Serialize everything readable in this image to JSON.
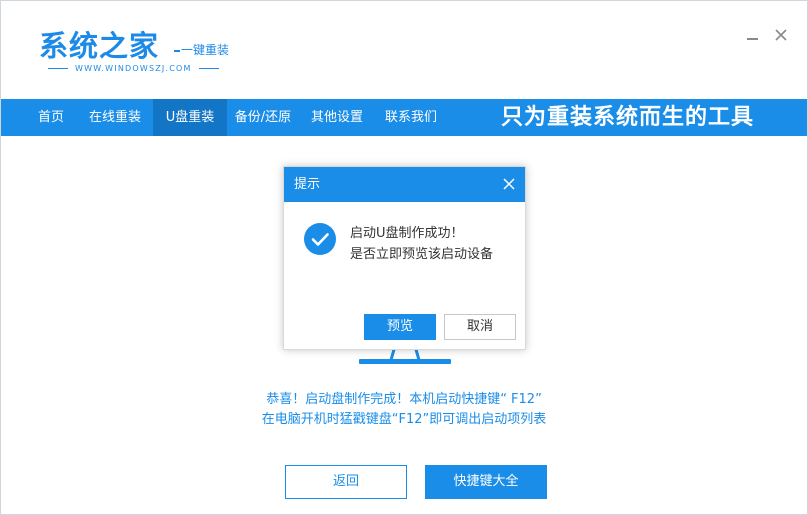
{
  "header": {
    "logo_title": "系统之家",
    "logo_subtitle": "一键重装",
    "logo_url": "WWW.WINDOWSZJ.COM"
  },
  "window_controls": {
    "minimize_icon": "minimize-icon",
    "close_icon": "close-icon"
  },
  "nav": {
    "items": [
      {
        "label": "首页",
        "active": false
      },
      {
        "label": "在线重装",
        "active": false
      },
      {
        "label": "U盘重装",
        "active": true
      },
      {
        "label": "备份/还原",
        "active": false
      },
      {
        "label": "其他设置",
        "active": false
      },
      {
        "label": "联系我们",
        "active": false
      }
    ],
    "slogan": "只为重装系统而生的工具"
  },
  "dialog": {
    "title": "提示",
    "icon": "check-circle-icon",
    "line1": "启动U盘制作成功！",
    "line2": "是否立即预览该启动设备",
    "ok_label": "预览",
    "cancel_label": "取消"
  },
  "main": {
    "message_line1": "恭喜！启动盘制作完成！本机启动快捷键“ F12”",
    "message_line2": "在电脑开机时猛戳键盘“F12”即可调出启动项列表",
    "back_label": "返回",
    "shortcut_keys_label": "快捷键大全"
  },
  "colors": {
    "accent": "#1a8de8",
    "nav_active": "#1375c5"
  }
}
